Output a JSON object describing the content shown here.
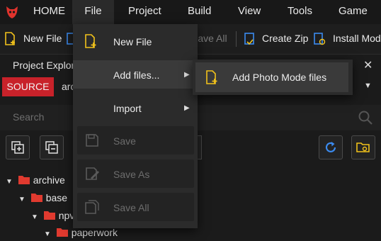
{
  "menubar": {
    "items": [
      "HOME",
      "File",
      "Project",
      "Build",
      "View",
      "Tools",
      "Game"
    ]
  },
  "toolbar": {
    "new_file": "New File",
    "save_all": "Save All",
    "create_zip": "Create Zip",
    "install_mod": "Install Mod"
  },
  "explorer": {
    "title": "Project Explore",
    "source": "SOURCE",
    "source_value": "arc",
    "search_placeholder": "Search",
    "tree": [
      "archive",
      "base",
      "npv",
      "paperwork"
    ]
  },
  "file_menu": {
    "items": [
      {
        "label": "New File",
        "icon": "new-file-icon",
        "enabled": true
      },
      {
        "label": "Add files...",
        "icon": "",
        "enabled": true,
        "submenu": true
      },
      {
        "label": "Import",
        "icon": "",
        "enabled": true,
        "submenu": true
      },
      {
        "label": "Save",
        "icon": "save-icon",
        "enabled": false
      },
      {
        "label": "Save As",
        "icon": "save-as-icon",
        "enabled": false
      },
      {
        "label": "Save All",
        "icon": "save-all-icon",
        "enabled": false
      }
    ]
  },
  "add_files_submenu": {
    "items": [
      {
        "label": "Add Photo Mode files",
        "icon": "add-photo-mode-icon"
      }
    ]
  },
  "colors": {
    "accent_yellow": "#f2c21b",
    "accent_blue": "#3b8bf0",
    "source_red": "#c8222a",
    "folder_red": "#e03a2f"
  }
}
